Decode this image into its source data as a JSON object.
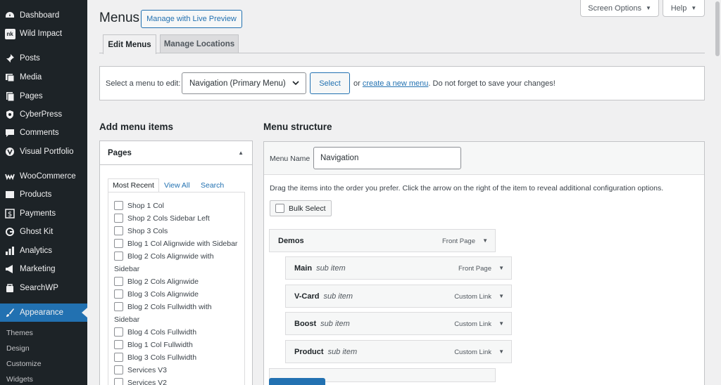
{
  "sidebar": {
    "items": [
      {
        "label": "Dashboard",
        "icon": "dashboard-icon"
      },
      {
        "label": "Wild Impact",
        "icon": "nk-logo-icon"
      },
      {
        "label": "Posts",
        "icon": "pin-icon"
      },
      {
        "label": "Media",
        "icon": "media-icon"
      },
      {
        "label": "Pages",
        "icon": "page-icon"
      },
      {
        "label": "CyberPress",
        "icon": "shield-icon"
      },
      {
        "label": "Comments",
        "icon": "comment-icon"
      },
      {
        "label": "Visual Portfolio",
        "icon": "vp-icon"
      },
      {
        "label": "WooCommerce",
        "icon": "woo-icon"
      },
      {
        "label": "Products",
        "icon": "products-icon"
      },
      {
        "label": "Payments",
        "icon": "payments-icon"
      },
      {
        "label": "Ghost Kit",
        "icon": "ghost-icon"
      },
      {
        "label": "Analytics",
        "icon": "analytics-icon"
      },
      {
        "label": "Marketing",
        "icon": "megaphone-icon"
      },
      {
        "label": "SearchWP",
        "icon": "searchwp-icon"
      },
      {
        "label": "Appearance",
        "icon": "brush-icon"
      }
    ],
    "submenu": [
      "Themes",
      "Design",
      "Customize",
      "Widgets"
    ],
    "logo_text": "nk"
  },
  "header": {
    "title": "Menus",
    "live_preview": "Manage with Live Preview",
    "screen_options": "Screen Options",
    "help": "Help"
  },
  "tabs": [
    "Edit Menus",
    "Manage Locations"
  ],
  "select_panel": {
    "label": "Select a menu to edit:",
    "selected": "Navigation (Primary Menu)",
    "button": "Select",
    "hint_before": "or",
    "hint_link": "create a new menu",
    "hint_after": ". Do not forget to save your changes!"
  },
  "add_items": {
    "heading": "Add menu items",
    "panel_title": "Pages",
    "tabs": [
      "Most Recent",
      "View All",
      "Search"
    ],
    "pages": [
      "Shop 1 Col",
      "Shop 2 Cols Sidebar Left",
      "Shop 3 Cols",
      "Blog 1 Col Alignwide with Sidebar",
      "Blog 2 Cols Alignwide with",
      "Sidebar",
      "Blog 2 Cols Alignwide",
      "Blog 3 Cols Alignwide",
      "Blog 2 Cols Fullwidth with",
      "Sidebar",
      "Blog 4 Cols Fullwidth",
      "Blog 1 Col Fullwidth",
      "Blog 3 Cols Fullwidth",
      "Services V3",
      "Services V2"
    ]
  },
  "structure": {
    "heading": "Menu structure",
    "name_label": "Menu Name",
    "name_value": "Navigation",
    "drag_hint": "Drag the items into the order you prefer. Click the arrow on the right of the item to reveal additional configuration options.",
    "bulk_select": "Bulk Select",
    "items": [
      {
        "title": "Demos",
        "sub": "",
        "type": "Front Page"
      },
      {
        "title": "Main",
        "sub": "sub item",
        "type": "Front Page"
      },
      {
        "title": "V-Card",
        "sub": "sub item",
        "type": "Custom Link"
      },
      {
        "title": "Boost",
        "sub": "sub item",
        "type": "Custom Link"
      },
      {
        "title": "Product",
        "sub": "sub item",
        "type": "Custom Link"
      }
    ]
  },
  "colors": {
    "sidebar_bg": "#1d2327",
    "accent": "#2271b1",
    "page_bg": "#f0f0f1"
  }
}
